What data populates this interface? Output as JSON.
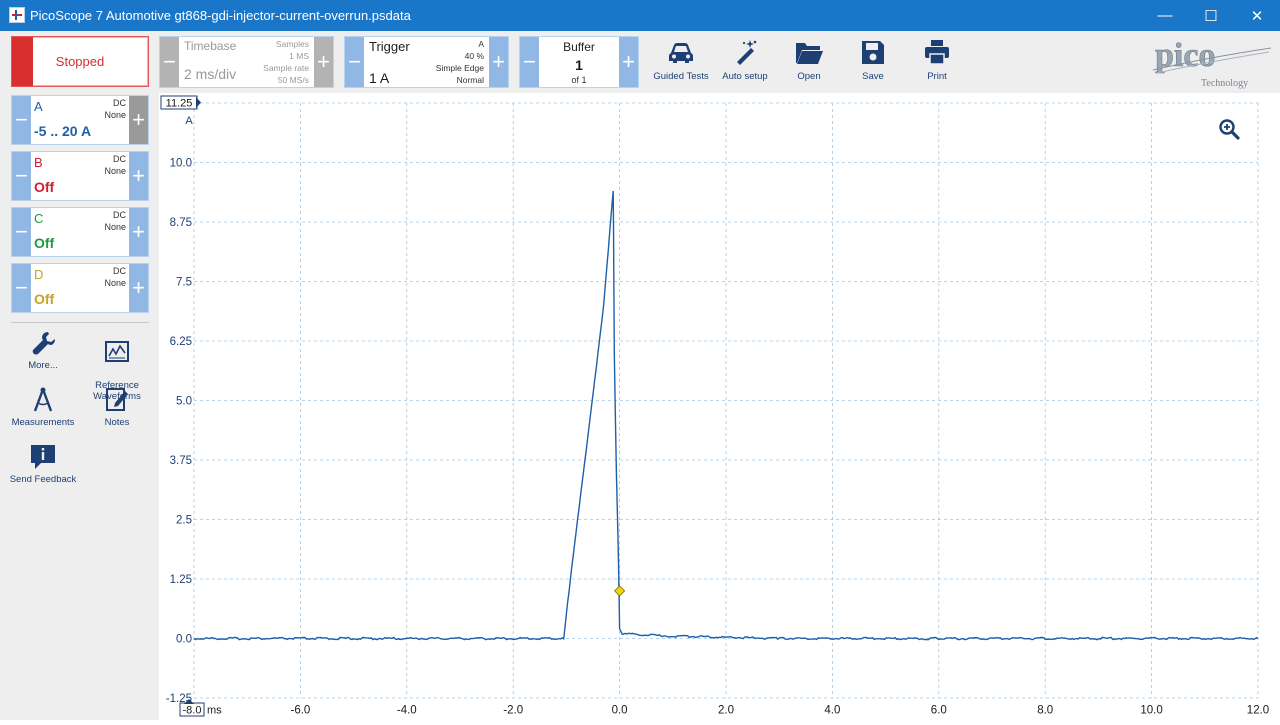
{
  "window": {
    "title": "PicoScope 7 Automotive gt868-gdi-injector-current-overrun.psdata",
    "minimize": "—",
    "maximize": "☐",
    "close": "✕"
  },
  "toolbar": {
    "run_state": "Stopped",
    "timebase": {
      "title": "Timebase",
      "value": "2 ms/div",
      "samples_label": "Samples",
      "samples": "1 MS",
      "rate_label": "Sample rate",
      "rate": "50 MS/s",
      "minus": "−",
      "plus": "+"
    },
    "trigger": {
      "title": "Trigger",
      "value": "1 A",
      "channel": "A",
      "position": "40 %",
      "type": "Simple Edge",
      "mode": "Normal",
      "minus": "−",
      "plus": "+"
    },
    "buffer": {
      "title": "Buffer",
      "value": "1",
      "of": "of 1",
      "minus": "−",
      "plus": "+"
    },
    "tools": [
      {
        "label": "Guided Tests",
        "icon": "car-icon"
      },
      {
        "label": "Auto setup",
        "icon": "wand-icon"
      },
      {
        "label": "Open",
        "icon": "folder-icon"
      },
      {
        "label": "Save",
        "icon": "floppy-icon"
      },
      {
        "label": "Print",
        "icon": "printer-icon"
      }
    ],
    "logo": {
      "text": "pico",
      "sub": "Technology"
    }
  },
  "channels": [
    {
      "name": "A",
      "coupling": "DC",
      "probe": "None",
      "range": "-5 .. 20 A",
      "color": "#1f5fa8"
    },
    {
      "name": "B",
      "coupling": "DC",
      "probe": "None",
      "range": "Off",
      "color": "#d0202f"
    },
    {
      "name": "C",
      "coupling": "DC",
      "probe": "None",
      "range": "Off",
      "color": "#1f9a3d"
    },
    {
      "name": "D",
      "coupling": "DC",
      "probe": "None",
      "range": "Off",
      "color": "#c9a227"
    }
  ],
  "side_tools": [
    {
      "label": "More...",
      "icon": "wrench-icon"
    },
    {
      "label": "Reference\nWaveforms",
      "icon": "reference-waveform-icon"
    },
    {
      "label": "Measurements",
      "icon": "compass-icon"
    },
    {
      "label": "Notes",
      "icon": "notes-icon"
    },
    {
      "label": "Send Feedback",
      "icon": "feedback-icon"
    }
  ],
  "chart_data": {
    "type": "line",
    "xlabel": "ms",
    "ylabel": "A",
    "xlim": [
      -8.0,
      12.0
    ],
    "ylim": [
      -1.25,
      11.25
    ],
    "xticks": [
      -8.0,
      -6.0,
      -4.0,
      -2.0,
      0.0,
      2.0,
      4.0,
      6.0,
      8.0,
      10.0,
      12.0
    ],
    "xtick_labels": [
      "-8.0",
      "-6.0",
      "-4.0",
      "-2.0",
      "0.0",
      "2.0",
      "4.0",
      "6.0",
      "8.0",
      "10.0",
      "12.0"
    ],
    "yticks": [
      -1.25,
      0.0,
      1.25,
      2.5,
      3.75,
      5.0,
      6.25,
      7.5,
      8.75,
      10.0,
      11.25
    ],
    "ytick_labels": [
      "-1.25",
      "0.0",
      "1.25",
      "2.5",
      "3.75",
      "5.0",
      "6.25",
      "7.5",
      "8.75",
      "10.0",
      "11.25"
    ],
    "grid": true,
    "trigger_marker": {
      "x": 0.0,
      "y": 1.0
    },
    "series": [
      {
        "name": "A",
        "color": "#1f5fa8",
        "x": [
          -8.0,
          -1.05,
          -1.0,
          -0.9,
          -0.6,
          -0.3,
          -0.12,
          -0.11,
          -0.1,
          -0.06,
          -0.02,
          0.0,
          0.05,
          0.3,
          1.0,
          3.0,
          6.0,
          12.0
        ],
        "y": [
          0.0,
          0.0,
          0.5,
          1.5,
          4.2,
          7.0,
          9.4,
          8.0,
          6.0,
          3.5,
          1.6,
          0.2,
          0.1,
          0.08,
          0.05,
          0.0,
          0.0,
          0.0
        ]
      }
    ]
  }
}
